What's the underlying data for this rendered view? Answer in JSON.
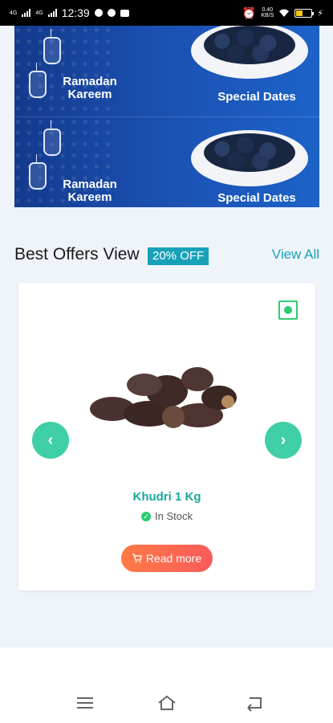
{
  "status_bar": {
    "network_1": "4G",
    "network_2": "4G",
    "time": "12:39",
    "speed_value": "0.40",
    "speed_unit": "KB/S"
  },
  "banner": {
    "rows": [
      {
        "left_text_line1": "Ramadan",
        "left_text_line2": "Kareem",
        "right_text": "Special Dates"
      },
      {
        "left_text_line1": "Ramadan",
        "left_text_line2": "Kareem",
        "right_text": "Special Dates"
      }
    ]
  },
  "offers": {
    "title": "Best Offers View",
    "badge": "20% OFF",
    "view_all": "View All"
  },
  "product": {
    "name": "Khudri 1 Kg",
    "stock": "In Stock",
    "button": "Read more"
  },
  "colors": {
    "accent_teal": "#17a2b8",
    "arrow_green": "#3ecfa6",
    "stock_green": "#2ecc71",
    "button_orange": "#ff7a45"
  }
}
